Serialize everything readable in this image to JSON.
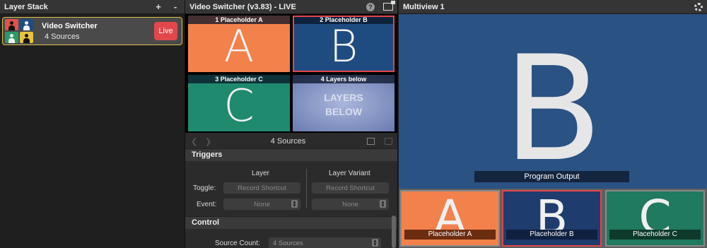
{
  "layer_stack": {
    "title": "Layer Stack",
    "add_label": "+",
    "remove_label": "-",
    "layer": {
      "name": "Video Switcher",
      "subtitle": "4 Sources",
      "live_label": "Live"
    }
  },
  "switcher": {
    "title": "Video Switcher (v3.83) - LIVE",
    "help_label": "?",
    "tiles": [
      {
        "label": "1 Placeholder A",
        "letter": "A",
        "color": "#f2814c"
      },
      {
        "label": "2 Placeholder B",
        "letter": "B",
        "color": "#1f4c80"
      },
      {
        "label": "3 Placeholder C",
        "letter": "C",
        "color": "#1f8a6e"
      },
      {
        "label": "4 Layers below",
        "text_line1": "LAYERS",
        "text_line2": "BELOW",
        "color": "#7d8fbf"
      }
    ],
    "nav_title": "4 Sources",
    "triggers": {
      "title": "Triggers",
      "col_layer": "Layer",
      "col_variant": "Layer Variant",
      "toggle_label": "Toggle:",
      "toggle_layer": "Record Shortcut",
      "toggle_variant": "Record Shortcut",
      "event_label": "Event:",
      "event_layer": "None",
      "event_variant": "None"
    },
    "control": {
      "title": "Control",
      "source_count_label": "Source Count:",
      "source_count_value": "4 Sources"
    }
  },
  "multiview": {
    "title": "Multiview 1",
    "program_letter": "B",
    "program_label": "Program Output",
    "program_color": "#2a5283",
    "previews": [
      {
        "letter": "A",
        "label": "Placeholder A",
        "color": "#f2814c",
        "label_bg": "#6b2c10"
      },
      {
        "letter": "B",
        "label": "Placeholder B",
        "color": "#1f3c6e",
        "label_bg": "#102040"
      },
      {
        "letter": "C",
        "label": "Placeholder C",
        "color": "#1f7a60",
        "label_bg": "#0e3a2c"
      }
    ]
  },
  "colors": {
    "live": "#e2474c",
    "selection_outline": "#e2474c",
    "layer_border": "#d8c048"
  }
}
